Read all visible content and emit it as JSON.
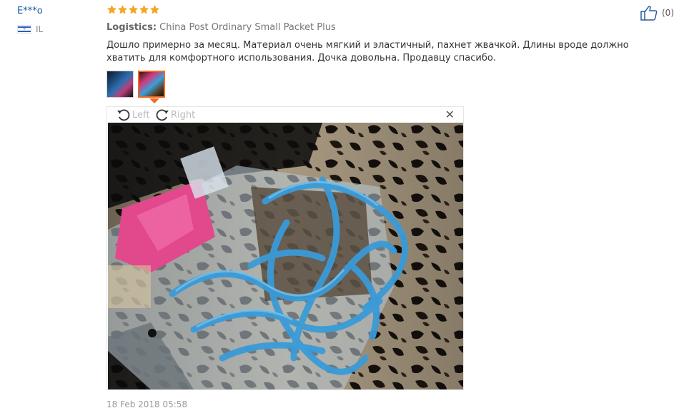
{
  "user": {
    "name": "E***o",
    "country_code": "IL",
    "flag_icon": "israel-flag-icon"
  },
  "review": {
    "rating": 5,
    "star_color": "#f5a623",
    "logistics_label": "Logistics:",
    "logistics_value": "China Post Ordinary Small Packet Plus",
    "text": "Дошло примерно за месяц. Материал очень мягкий и эластичный, пахнет жвачкой. Длины вроде должно хватить для комфортного использования. Дочка довольна. Продавцу спасибо.",
    "date": "18 Feb 2018 05:58"
  },
  "photos": {
    "thumbnails": [
      "photo-thumbnail-1",
      "photo-thumbnail-2"
    ],
    "selected_index": 1,
    "selected_color": "#f06a22"
  },
  "viewer": {
    "rotate_left_label": "Left",
    "rotate_right_label": "Right",
    "close_icon": "close-icon"
  },
  "helpful": {
    "count": "(0)",
    "icon": "thumbs-up-icon"
  }
}
